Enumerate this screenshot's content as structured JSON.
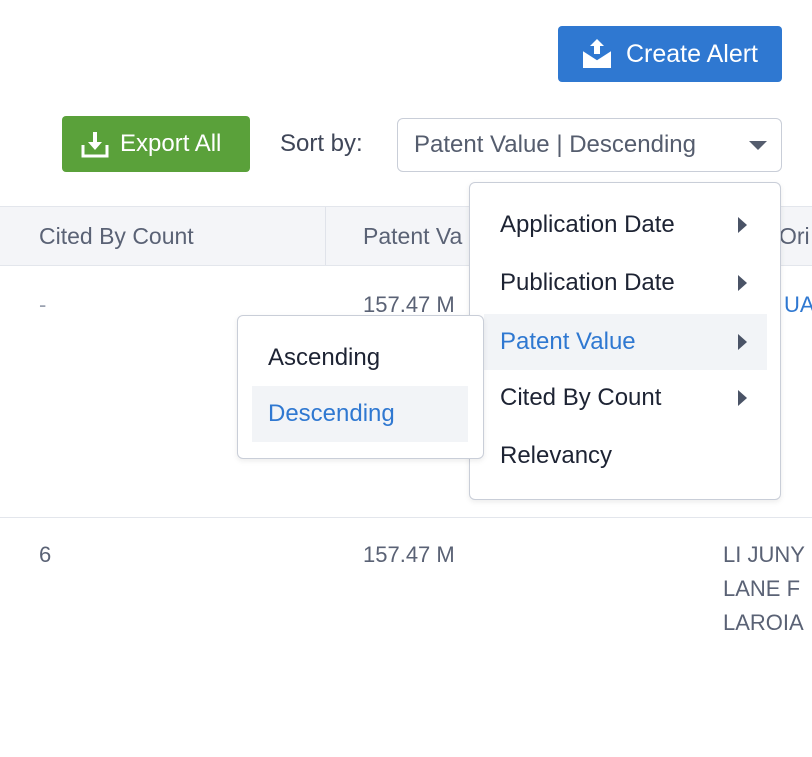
{
  "actions": {
    "create_alert_label": "Create Alert",
    "export_all_label": "Export All"
  },
  "sort": {
    "label": "Sort by:",
    "selected": "Patent Value | Descending",
    "menu": [
      {
        "label": "Application Date",
        "has_submenu": true
      },
      {
        "label": "Publication Date",
        "has_submenu": true
      },
      {
        "label": "Patent Value",
        "has_submenu": true,
        "active": true
      },
      {
        "label": "Cited By Count",
        "has_submenu": true
      },
      {
        "label": "Relevancy",
        "has_submenu": false
      }
    ],
    "submenu": [
      {
        "label": "Ascending"
      },
      {
        "label": "Descending",
        "active": true
      }
    ]
  },
  "table": {
    "headers": [
      "Cited By Count",
      "Patent Va",
      "Ori"
    ],
    "rows": [
      {
        "cited_by": "-",
        "patent_value": "157.47 M",
        "owner_lines": [
          "UA"
        ]
      },
      {
        "cited_by": "6",
        "patent_value": "157.47 M",
        "owner_lines": [
          "LI JUNY",
          "LANE F",
          "LAROIA"
        ]
      }
    ]
  },
  "colors": {
    "primary_blue": "#2f78d1",
    "export_green": "#5aa13a",
    "header_bg": "#f4f5f8"
  },
  "icons": {
    "create_alert": "envelope-upload-icon",
    "export_all": "download-tray-icon",
    "select_caret": "caret-down-icon",
    "submenu_arrow": "caret-right-icon"
  }
}
